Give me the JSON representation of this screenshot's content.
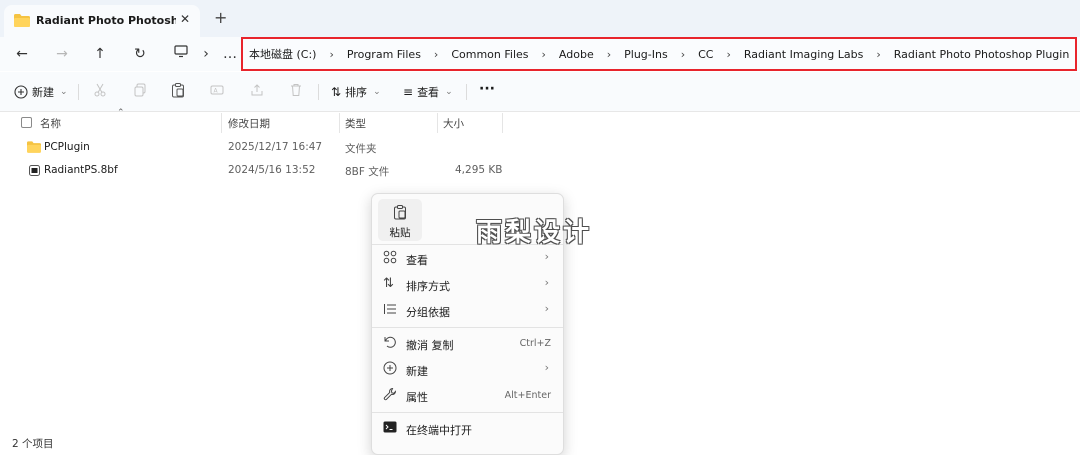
{
  "window": {
    "tab_title": "Radiant Photo Photoshop Plug",
    "tab_close": "✕",
    "new_tab": "+"
  },
  "nav": {
    "back": "←",
    "forward": "→",
    "up": "↑",
    "refresh": "↻",
    "more": "…",
    "chevron": "›"
  },
  "breadcrumbs": [
    "本地磁盘 (C:)",
    "Program Files",
    "Common Files",
    "Adobe",
    "Plug-Ins",
    "CC",
    "Radiant Imaging Labs",
    "Radiant Photo Photoshop Plugin"
  ],
  "crumb_separator": "›",
  "toolbar": {
    "new_label": "新建",
    "sort_label": "排序",
    "view_label": "查看",
    "more": "···"
  },
  "columns": {
    "name": "名称",
    "modified": "修改日期",
    "type": "类型",
    "size": "大小"
  },
  "files": [
    {
      "name": "PCPlugin",
      "modified": "2025/12/17 16:47",
      "type": "文件夹",
      "size": "",
      "kind": "folder"
    },
    {
      "name": "RadiantPS.8bf",
      "modified": "2024/5/16 13:52",
      "type": "8BF 文件",
      "size": "4,295 KB",
      "kind": "file"
    }
  ],
  "status": {
    "count": "2 个项目"
  },
  "watermark": "雨梨设计",
  "context_menu": {
    "paste_label": "粘贴",
    "items": [
      {
        "label": "查看",
        "arrow": "›",
        "shortcut": ""
      },
      {
        "label": "排序方式",
        "arrow": "›",
        "shortcut": ""
      },
      {
        "label": "分组依据",
        "arrow": "›",
        "shortcut": ""
      },
      {
        "label": "撤消 复制",
        "arrow": "",
        "shortcut": "Ctrl+Z"
      },
      {
        "label": "新建",
        "arrow": "›",
        "shortcut": ""
      },
      {
        "label": "属性",
        "arrow": "",
        "shortcut": "Alt+Enter"
      },
      {
        "label": "在终端中打开",
        "arrow": "",
        "shortcut": ""
      }
    ]
  },
  "colors": {
    "highlight_border": "#e8242c",
    "folder": "#f5c342",
    "accent": "#0067c0"
  }
}
